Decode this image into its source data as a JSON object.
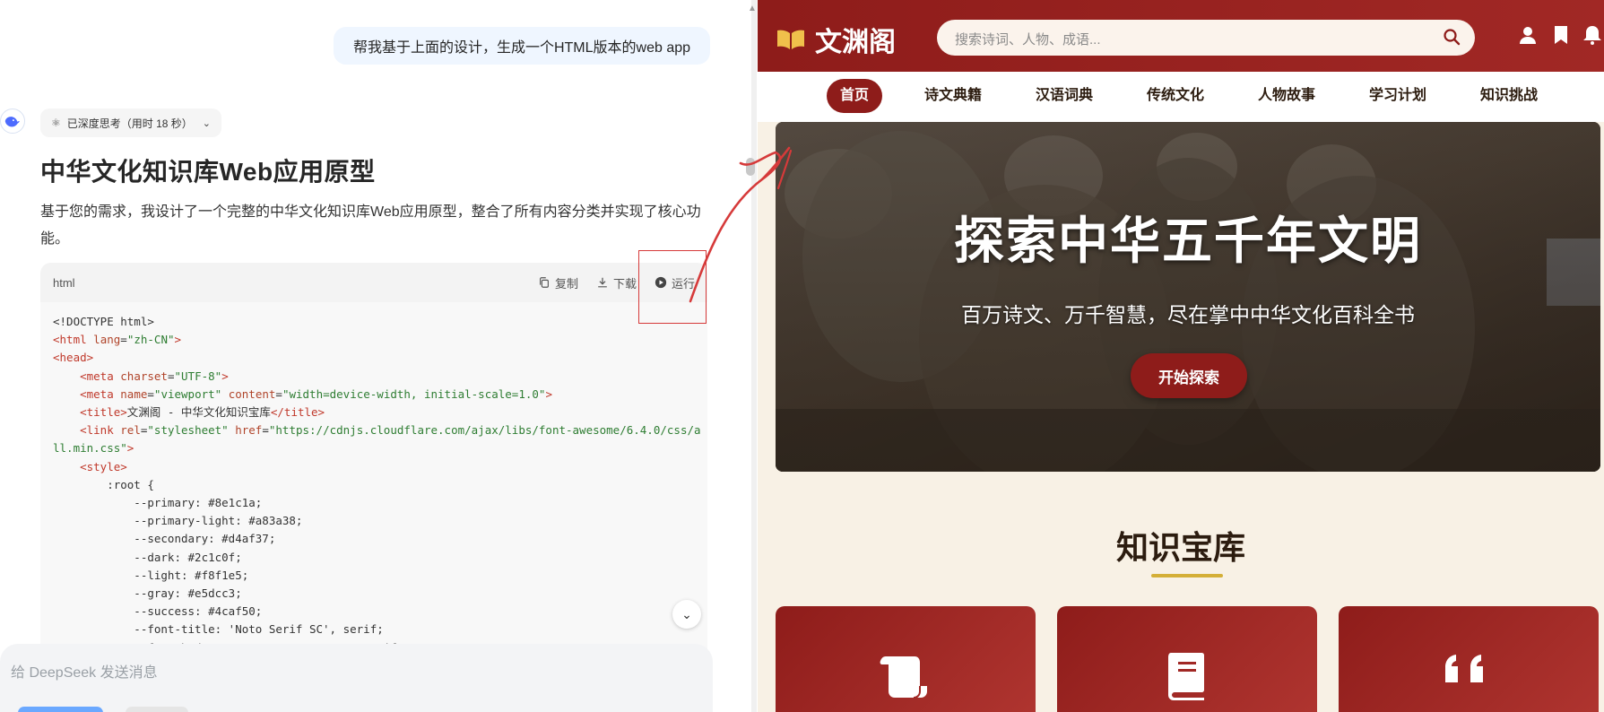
{
  "chat": {
    "user_message": "帮我基于上面的设计，生成一个HTML版本的web app",
    "think_chip": "已深度思考（用时 18 秒）",
    "answer_title": "中华文化知识库Web应用原型",
    "answer_para": "基于您的需求，我设计了一个完整的中华文化知识库Web应用原型，整合了所有内容分类并实现了核心功能。",
    "code_block": {
      "lang": "html",
      "copy_label": "复制",
      "download_label": "下载",
      "run_label": "运行"
    },
    "composer_placeholder": "给 DeepSeek 发送消息"
  },
  "preview": {
    "logo_text": "文渊阁",
    "search_placeholder": "搜索诗词、人物、成语...",
    "nav": [
      "首页",
      "诗文典籍",
      "汉语词典",
      "传统文化",
      "人物故事",
      "学习计划",
      "知识挑战"
    ],
    "active_nav": "首页",
    "hero_title": "探索中华五千年文明",
    "hero_subtitle": "百万诗文、万千智慧，尽在掌中中华文化百科全书",
    "hero_cta": "开始探索",
    "section_title": "知识宝库",
    "cards": [
      {
        "icon": "scroll-icon"
      },
      {
        "icon": "book-icon"
      },
      {
        "icon": "quote-icon"
      }
    ]
  },
  "colors": {
    "primary": "#8e1c1a",
    "secondary": "#d4af37",
    "light": "#f8f1e5",
    "dark": "#2c1c0f",
    "annotation_red": "#d63a3a"
  }
}
